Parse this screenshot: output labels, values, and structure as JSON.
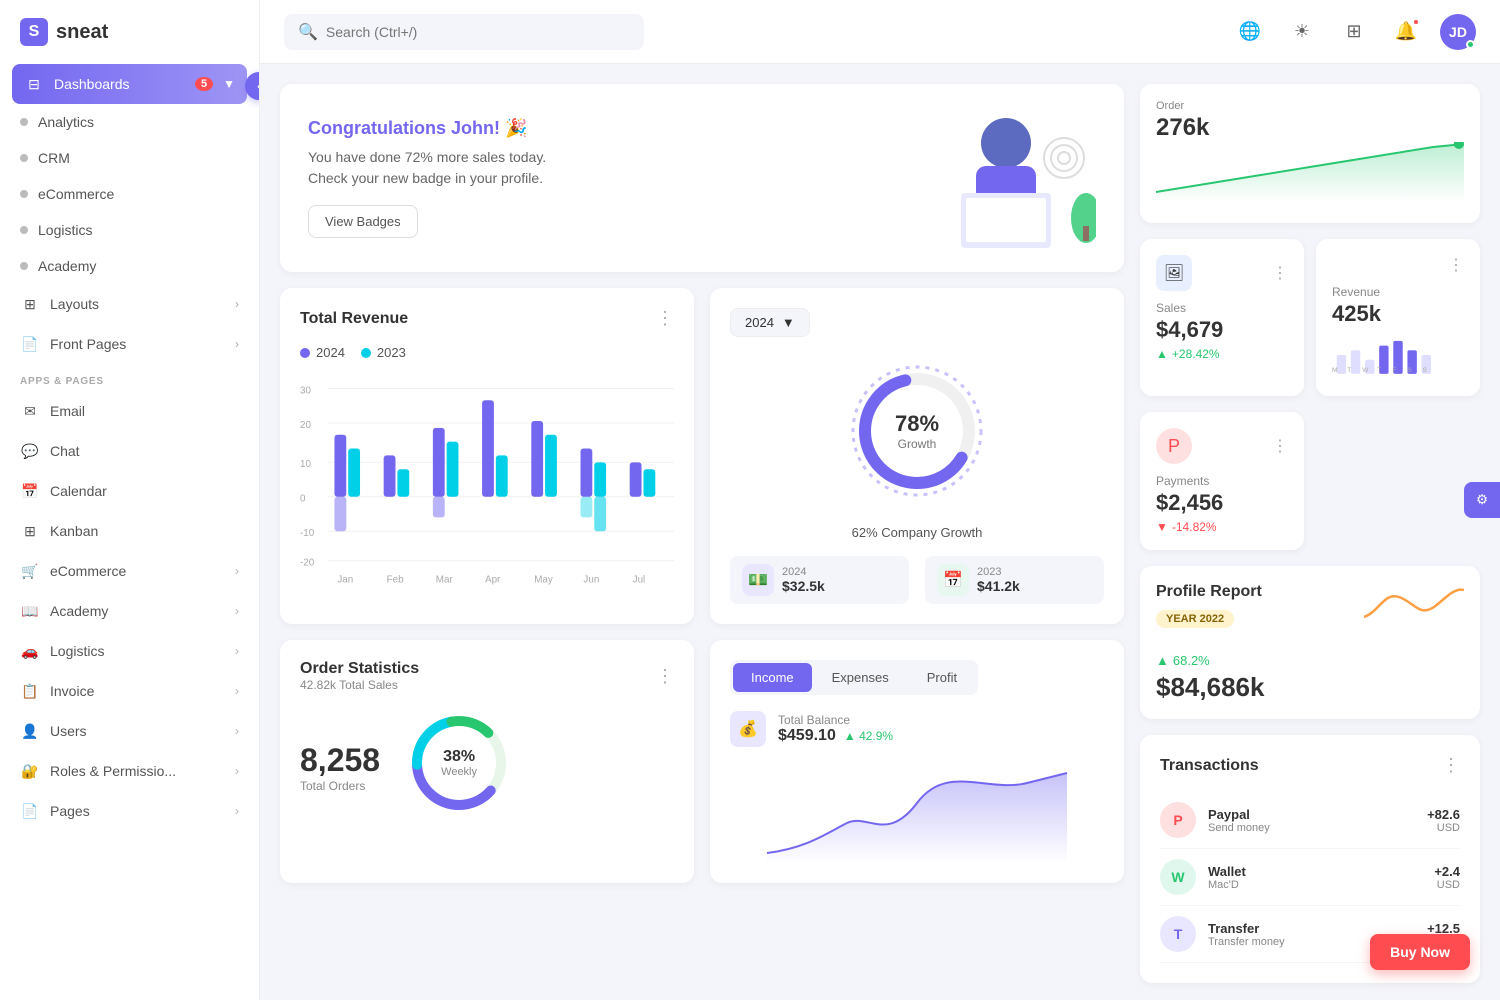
{
  "app": {
    "name": "sneat"
  },
  "sidebar": {
    "dashboards_label": "Dashboards",
    "dashboards_badge": "5",
    "section_label": "APPS & PAGES",
    "items_top": [
      {
        "id": "analytics",
        "label": "Analytics",
        "dot": true
      },
      {
        "id": "crm",
        "label": "CRM",
        "dot": true
      },
      {
        "id": "ecommerce",
        "label": "eCommerce",
        "dot": true
      },
      {
        "id": "logistics",
        "label": "Logistics",
        "dot": true
      },
      {
        "id": "academy",
        "label": "Academy",
        "dot": true
      }
    ],
    "items_middle": [
      {
        "id": "layouts",
        "label": "Layouts",
        "has_arrow": true
      },
      {
        "id": "front-pages",
        "label": "Front Pages",
        "has_arrow": true
      }
    ],
    "items_apps": [
      {
        "id": "email",
        "label": "Email",
        "icon": "✉"
      },
      {
        "id": "chat",
        "label": "Chat",
        "icon": "💬"
      },
      {
        "id": "calendar",
        "label": "Calendar",
        "icon": "📅"
      },
      {
        "id": "kanban",
        "label": "Kanban",
        "icon": "⊞"
      },
      {
        "id": "ecommerce2",
        "label": "eCommerce",
        "icon": "🛒",
        "has_arrow": true
      },
      {
        "id": "academy2",
        "label": "Academy",
        "icon": "📖",
        "has_arrow": true
      },
      {
        "id": "logistics2",
        "label": "Logistics",
        "icon": "🚗",
        "has_arrow": true
      },
      {
        "id": "invoice",
        "label": "Invoice",
        "icon": "📋",
        "has_arrow": true
      },
      {
        "id": "users",
        "label": "Users",
        "icon": "👤",
        "has_arrow": true
      },
      {
        "id": "roles",
        "label": "Roles & Permissio...",
        "icon": "🔐",
        "has_arrow": true
      },
      {
        "id": "pages",
        "label": "Pages",
        "icon": "📄",
        "has_arrow": true
      }
    ]
  },
  "header": {
    "search_placeholder": "Search (Ctrl+/)"
  },
  "welcome": {
    "title": "Congratulations John! 🎉",
    "description_line1": "You have done 72% more sales today.",
    "description_line2": "Check your new badge in your profile.",
    "button_label": "View Badges"
  },
  "order_card": {
    "label": "Order",
    "value": "276k"
  },
  "sales_card": {
    "label": "Sales",
    "value": "$4,679",
    "change": "+28.42%",
    "change_dir": "up"
  },
  "revenue": {
    "title": "Total Revenue",
    "legend": [
      {
        "label": "2024",
        "color": "#7367f0"
      },
      {
        "label": "2023",
        "color": "#00cfe8"
      }
    ],
    "y_labels": [
      "30",
      "20",
      "10",
      "0",
      "-10",
      "-20"
    ],
    "x_labels": [
      "Jan",
      "Feb",
      "Mar",
      "Apr",
      "May",
      "Jun",
      "Jul"
    ],
    "bars_2024": [
      18,
      12,
      20,
      28,
      22,
      14,
      10
    ],
    "bars_2023": [
      14,
      8,
      16,
      12,
      18,
      10,
      8
    ]
  },
  "growth": {
    "year": "2024",
    "percent": "78%",
    "label": "Growth",
    "subtitle": "62% Company Growth",
    "stat_2024": {
      "label": "2024",
      "value": "$32.5k"
    },
    "stat_2023": {
      "label": "2023",
      "value": "$41.2k"
    }
  },
  "payments_card": {
    "label": "Payments",
    "value": "$2,456",
    "change": "-14.82%",
    "change_dir": "down"
  },
  "revenue_card": {
    "label": "Revenue",
    "value": "425k",
    "days": [
      "M",
      "T",
      "W",
      "T",
      "F",
      "S",
      "S"
    ]
  },
  "profile_report": {
    "title": "Profile Report",
    "year_badge": "YEAR 2022",
    "change": "68.2%",
    "value": "$84,686k"
  },
  "transactions": {
    "title": "Transactions",
    "items": [
      {
        "id": "paypal",
        "name": "Paypal",
        "desc": "Send money",
        "amount": "+82.6",
        "currency": "USD",
        "color": "#ff4c51",
        "icon": "P"
      },
      {
        "id": "wallet",
        "name": "Wallet",
        "desc": "Mac'D",
        "amount": "+2.4",
        "currency": "USD",
        "color": "#28c76f",
        "icon": "W"
      }
    ]
  },
  "order_statistics": {
    "title": "Order Statistics",
    "subtitle": "42.82k Total Sales",
    "total_orders": "8,258",
    "orders_label": "Total Orders",
    "weekly_percent": "38%",
    "weekly_label": "Weekly",
    "tabs": [
      "Income",
      "Expenses",
      "Profit"
    ],
    "active_tab": "Income"
  },
  "income": {
    "total_balance_label": "Total Balance",
    "total_balance_value": "$459.10",
    "total_balance_change": "42.9%"
  },
  "buy_now": {
    "label": "Buy Now"
  }
}
